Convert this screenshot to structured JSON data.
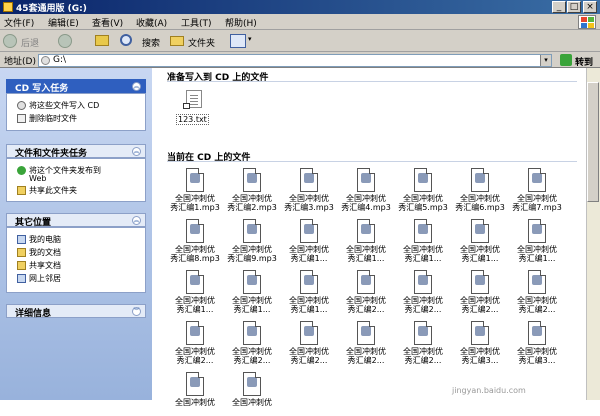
{
  "window": {
    "title": "45套通用版 (G:)"
  },
  "menu": [
    "文件(F)",
    "编辑(E)",
    "查看(V)",
    "收藏(A)",
    "工具(T)",
    "帮助(H)"
  ],
  "toolbar": {
    "back": "后退",
    "search": "搜索",
    "folders": "文件夹"
  },
  "address": {
    "label": "地址(D)",
    "value": "G:\\",
    "go": "转到"
  },
  "left_panel": {
    "cd_tasks": {
      "title": "CD 写入任务",
      "items": [
        "将这些文件写入 CD",
        "删除临时文件"
      ]
    },
    "file_tasks": {
      "title": "文件和文件夹任务",
      "items": [
        "将这个文件夹发布到",
        "Web",
        "共享此文件夹"
      ]
    },
    "other_places": {
      "title": "其它位置",
      "items": [
        "我的电脑",
        "我的文档",
        "共享文档",
        "网上邻居"
      ]
    },
    "details": {
      "title": "详细信息"
    }
  },
  "main": {
    "pending_title": "准备写入到 CD 上的文件",
    "pending_file": "123.txt",
    "current_title": "当前在 CD 上的文件",
    "files": [
      [
        "全国冲刺优",
        "秀汇编1.mp3"
      ],
      [
        "全国冲刺优",
        "秀汇编2.mp3"
      ],
      [
        "全国冲刺优",
        "秀汇编3.mp3"
      ],
      [
        "全国冲刺优",
        "秀汇编4.mp3"
      ],
      [
        "全国冲刺优",
        "秀汇编5.mp3"
      ],
      [
        "全国冲刺优",
        "秀汇编6.mp3"
      ],
      [
        "全国冲刺优",
        "秀汇编7.mp3"
      ],
      [
        "全国冲刺优",
        "秀汇编8.mp3"
      ],
      [
        "全国冲刺优",
        "秀汇编9.mp3"
      ],
      [
        "全国冲刺优",
        "秀汇编1..."
      ],
      [
        "全国冲刺优",
        "秀汇编1..."
      ],
      [
        "全国冲刺优",
        "秀汇编1..."
      ],
      [
        "全国冲刺优",
        "秀汇编1..."
      ],
      [
        "全国冲刺优",
        "秀汇编1..."
      ],
      [
        "全国冲刺优",
        "秀汇编1..."
      ],
      [
        "全国冲刺优",
        "秀汇编1..."
      ],
      [
        "全国冲刺优",
        "秀汇编1..."
      ],
      [
        "全国冲刺优",
        "秀汇编2..."
      ],
      [
        "全国冲刺优",
        "秀汇编2..."
      ],
      [
        "全国冲刺优",
        "秀汇编2..."
      ],
      [
        "全国冲刺优",
        "秀汇编2..."
      ],
      [
        "全国冲刺优",
        "秀汇编2..."
      ],
      [
        "全国冲刺优",
        "秀汇编2..."
      ],
      [
        "全国冲刺优",
        "秀汇编2..."
      ],
      [
        "全国冲刺优",
        "秀汇编2..."
      ],
      [
        "全国冲刺优",
        "秀汇编2..."
      ],
      [
        "全国冲刺优",
        "秀汇编3..."
      ],
      [
        "全国冲刺优",
        "秀汇编3..."
      ],
      [
        "全国冲刺优",
        ""
      ],
      [
        "全国冲刺优",
        ""
      ]
    ]
  },
  "watermark": "jingyan.baidu.com"
}
